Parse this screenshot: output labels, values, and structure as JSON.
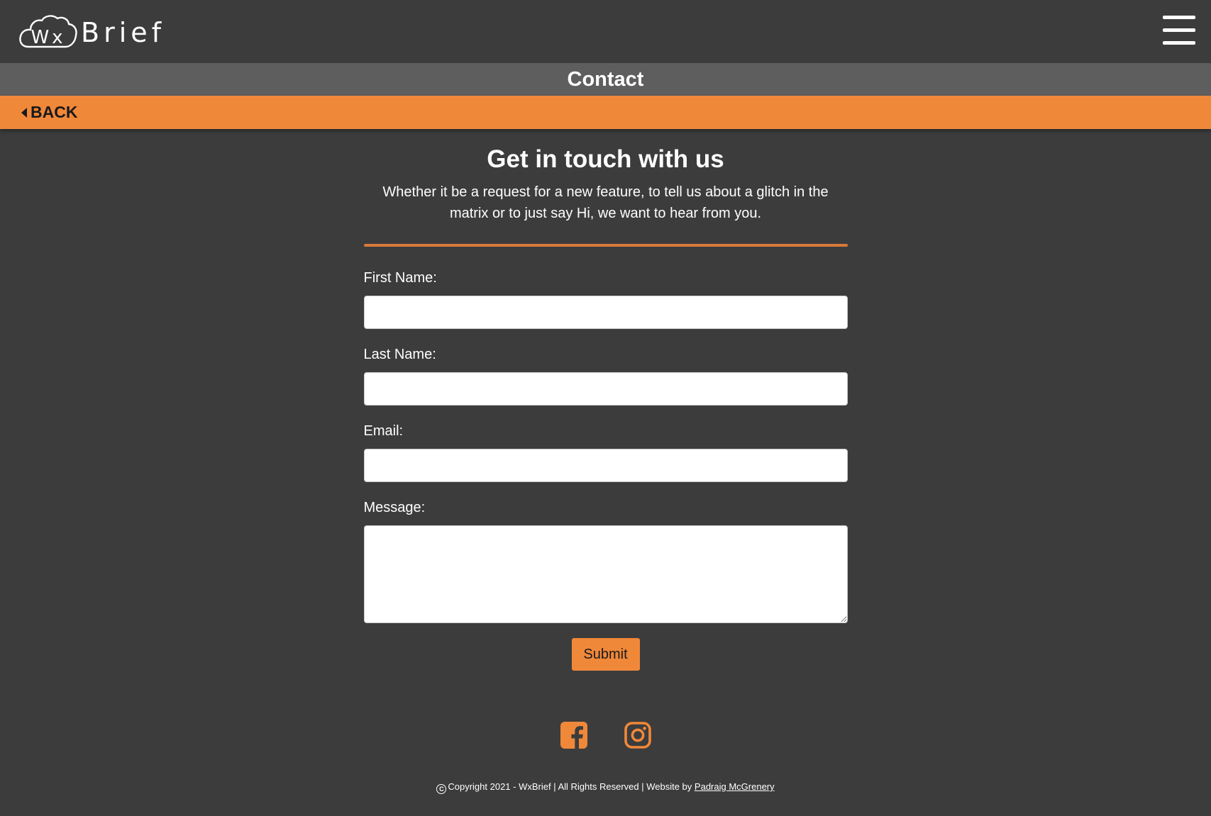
{
  "header": {
    "logo_prefix": "Wx",
    "logo_suffix": "Brief",
    "menu_icon": "hamburger-menu-icon"
  },
  "titlebar": {
    "title": "Contact"
  },
  "nav": {
    "back_label": "BACK",
    "back_icon": "caret-left-icon"
  },
  "main": {
    "heading": "Get in touch with us",
    "intro": "Whether it be a request for a new feature, to tell us about a glitch in the matrix or to just say Hi, we want to hear from you."
  },
  "form": {
    "first_name_label": "First Name:",
    "first_name_value": "",
    "last_name_label": "Last Name:",
    "last_name_value": "",
    "email_label": "Email:",
    "email_value": "",
    "message_label": "Message:",
    "message_value": "",
    "submit_label": "Submit"
  },
  "social": {
    "icons": [
      "facebook-icon",
      "instagram-icon"
    ]
  },
  "footer": {
    "copyright_text": "Copyright 2021 - WxBrief | All Rights Reserved | Website by",
    "author_link": "Padraig McGrenery"
  },
  "colors": {
    "background": "#3c3c3c",
    "titlebar": "#5e5e5e",
    "accent": "#f0883a",
    "divider": "#d9793a"
  }
}
